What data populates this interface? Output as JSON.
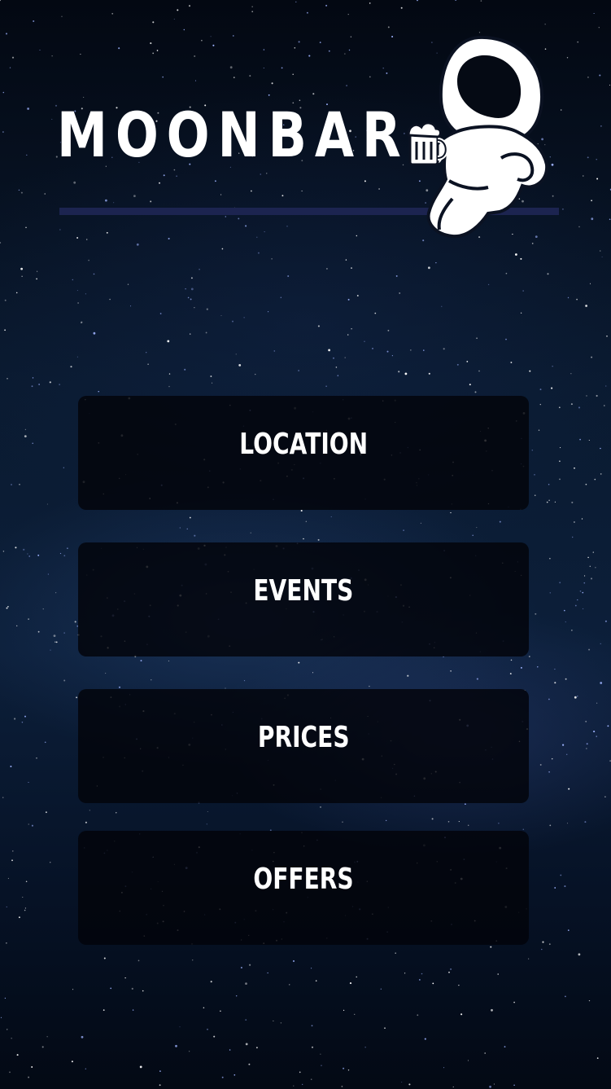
{
  "app": {
    "title": "MOONBAR"
  },
  "mascot": {
    "icon": "astronaut-with-beer-icon"
  },
  "menu": {
    "items": [
      {
        "label": "LOCATION"
      },
      {
        "label": "EVENTS"
      },
      {
        "label": "PRICES"
      },
      {
        "label": "OFFERS"
      }
    ]
  },
  "colors": {
    "background": "#0a1a30",
    "divider": "#1c2450",
    "button": "#02040a",
    "text": "#ffffff"
  }
}
